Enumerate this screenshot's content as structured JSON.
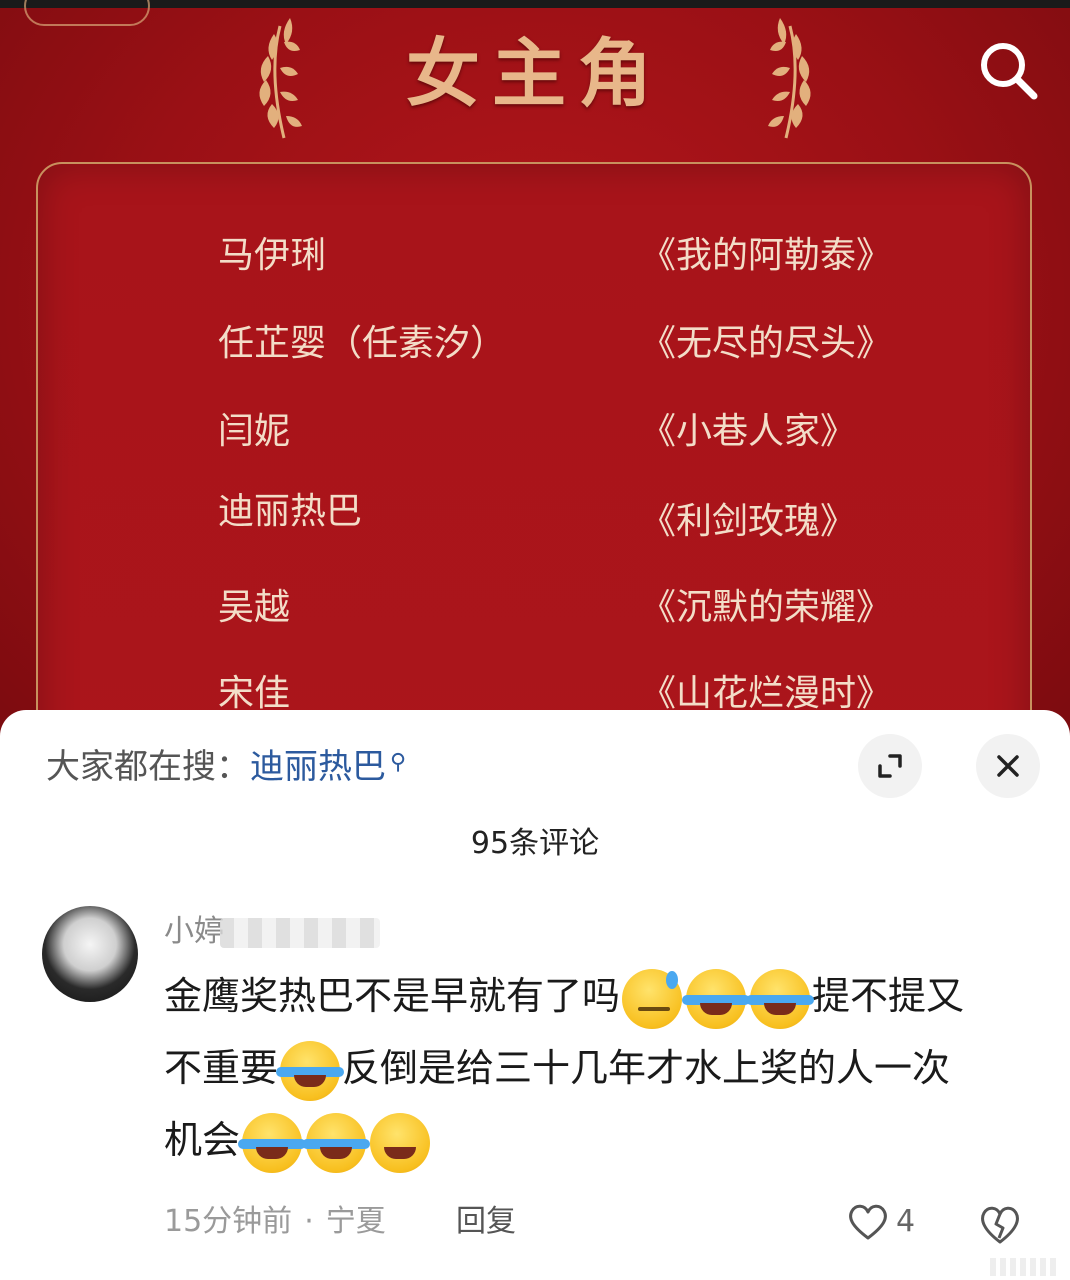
{
  "poster": {
    "title": "女主角",
    "nominees": [
      {
        "name": "马伊琍",
        "work": "《我的阿勒泰》"
      },
      {
        "name": "任芷婴（任素汐）",
        "work": "《无尽的尽头》"
      },
      {
        "name": "闫妮",
        "work": "《小巷人家》"
      },
      {
        "name": "迪丽热巴",
        "work": "《利剑玫瑰》"
      },
      {
        "name": "吴越",
        "work": "《沉默的荣耀》"
      },
      {
        "name": "宋佳",
        "work": "《山花烂漫时》"
      }
    ],
    "colors": {
      "background": "#9a1015",
      "gold": "#e8b78a"
    }
  },
  "icons": {
    "search": "search-icon",
    "expand": "expand-icon",
    "close": "close-icon",
    "like": "heart-icon",
    "dislike": "broken-heart-icon"
  },
  "sheet": {
    "trending_label": "大家都在搜：",
    "trending_term": "迪丽热巴",
    "comment_count": "95条评论"
  },
  "comment": {
    "username": "小婷",
    "line1_a": "金鹰奖热巴不是早就有了吗",
    "line1_b": "提不提又",
    "line2_a": "不重要",
    "line2_b": "反倒是给三十几年才水上奖的人一次",
    "line3": "机会",
    "time": "15分钟前",
    "location": "宁夏",
    "reply": "回复",
    "likes": "4"
  }
}
